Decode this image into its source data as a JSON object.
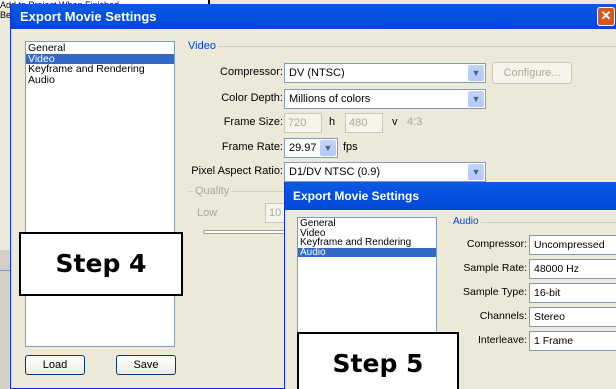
{
  "background_window": {
    "line1": "Add to Project When Finished",
    "line2": "Be"
  },
  "main_dialog": {
    "title": "Export Movie Settings",
    "close_glyph": "✕",
    "categories": [
      "General",
      "Video",
      "Keyframe and Rendering",
      "Audio"
    ],
    "selected_index": 1,
    "buttons": {
      "load": "Load",
      "save": "Save"
    },
    "video": {
      "group_label": "Video",
      "compressor_label": "Compressor:",
      "compressor_value": "DV (NTSC)",
      "configure_label": "Configure...",
      "color_depth_label": "Color Depth:",
      "color_depth_value": "Millions of colors",
      "frame_size_label": "Frame Size:",
      "frame_width": "720",
      "h_label": "h",
      "frame_height": "480",
      "v_label": "v",
      "aspect_text": "4:3",
      "frame_rate_label": "Frame Rate:",
      "frame_rate_value": "29.97",
      "fps_label": "fps",
      "pixel_aspect_label": "Pixel Aspect Ratio:",
      "pixel_aspect_value": "D1/DV NTSC (0.9)",
      "quality_label": "Quality",
      "quality_low": "Low",
      "quality_value": "10"
    }
  },
  "audio_dialog": {
    "title": "Export Movie Settings",
    "categories": [
      "General",
      "Video",
      "Keyframe and Rendering",
      "Audio"
    ],
    "selected_index": 3,
    "group_label": "Audio",
    "compressor_label": "Compressor:",
    "compressor_value": "Uncompressed",
    "sample_rate_label": "Sample Rate:",
    "sample_rate_value": "48000 Hz",
    "sample_type_label": "Sample Type:",
    "sample_type_value": "16-bit",
    "channels_label": "Channels:",
    "channels_value": "Stereo",
    "interleave_label": "Interleave:",
    "interleave_value": "1 Frame"
  },
  "callouts": {
    "step4": "Step 4",
    "step5": "Step 5"
  },
  "colors": {
    "titlebar": "#0551E3",
    "selection": "#316AC5",
    "group_label": "#0046D5",
    "dialog_bg": "#ECE9D8"
  }
}
